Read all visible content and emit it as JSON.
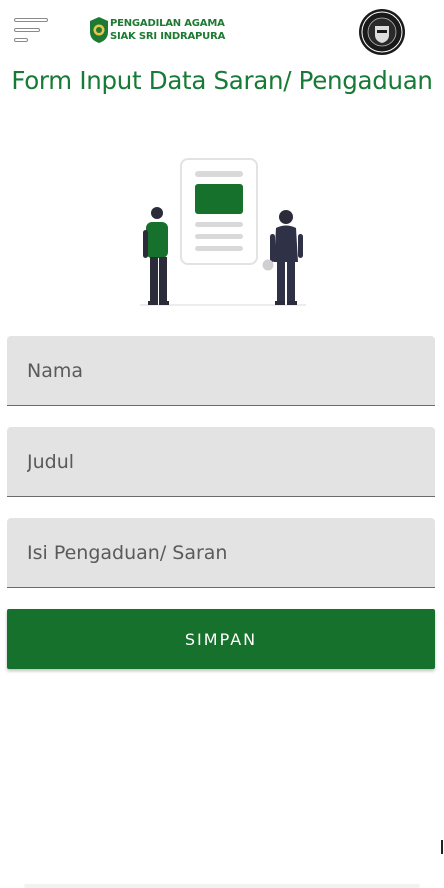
{
  "header": {
    "logo_line1": "PENGADILAN AGAMA",
    "logo_line2": "SIAK SRI INDRAPURA",
    "menu_icon": "hamburger-menu-icon",
    "seal_icon": "integrity-zone-seal-icon"
  },
  "page": {
    "title": "Form Input Data Saran/ Pengaduan"
  },
  "form": {
    "nama_placeholder": "Nama",
    "judul_placeholder": "Judul",
    "isi_placeholder": "Isi Pengaduan/ Saran",
    "submit_label": "SIMPAN"
  },
  "colors": {
    "brand_green": "#16712c",
    "title_green": "#177a36",
    "field_bg": "#e3e3e3"
  }
}
